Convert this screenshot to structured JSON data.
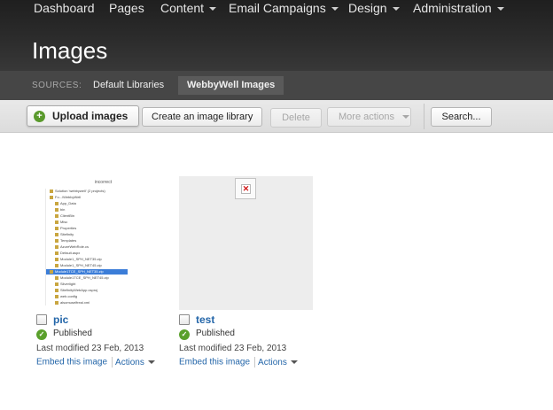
{
  "nav": {
    "items": [
      {
        "label": "Dashboard",
        "dropdown": false
      },
      {
        "label": "Pages",
        "dropdown": false
      },
      {
        "label": "Content",
        "dropdown": true
      },
      {
        "label": "Email Campaigns",
        "dropdown": true
      },
      {
        "label": "Design",
        "dropdown": true
      },
      {
        "label": "Administration",
        "dropdown": true
      }
    ]
  },
  "page": {
    "title": "Images"
  },
  "sources": {
    "label": "SOURCES:",
    "tabs": [
      {
        "label": "Default Libraries",
        "active": false
      },
      {
        "label": "WebbyWell Images",
        "active": true
      }
    ]
  },
  "toolbar": {
    "upload_label": "Upload images",
    "upload_icon": "+",
    "create_library_label": "Create an image library",
    "delete_label": "Delete",
    "more_actions_label": "More actions",
    "search_label": "Search..."
  },
  "images": [
    {
      "title": "pic",
      "status": "Published",
      "modified": "Last modified 23 Feb, 2013",
      "embed_label": "Embed this image",
      "actions_label": "Actions",
      "thumbnail": {
        "kind": "screenshot",
        "header": "incorrect",
        "tree": [
          "Solution 'webbywell' (2 projects)",
          "Fo...\\WebbyWell",
          "App_Data",
          "bin",
          "ClientBin",
          "Misc",
          "Properties",
          "Sitefinity",
          "Templates",
          "AzureWebRole.cs",
          "Default.aspx",
          "Module1_SPH_NET35.zip",
          "Module1_SPH_NET45.zip",
          "Module1TCE_SPH_NET35.zip",
          "Module1TCE_SPH_NET45.zip",
          "Silverlight",
          "SitefinityWebApp.csproj",
          "web.config",
          "alsomuselfreal.xml"
        ],
        "selected_index": 13
      }
    },
    {
      "title": "test",
      "status": "Published",
      "modified": "Last modified 23 Feb, 2013",
      "embed_label": "Embed this image",
      "actions_label": "Actions",
      "thumbnail": {
        "kind": "broken",
        "broken_glyph": "✕"
      }
    }
  ],
  "colors": {
    "link": "#2466a9",
    "published": "#5aa02c",
    "header_bg": "#2c2c2c"
  }
}
